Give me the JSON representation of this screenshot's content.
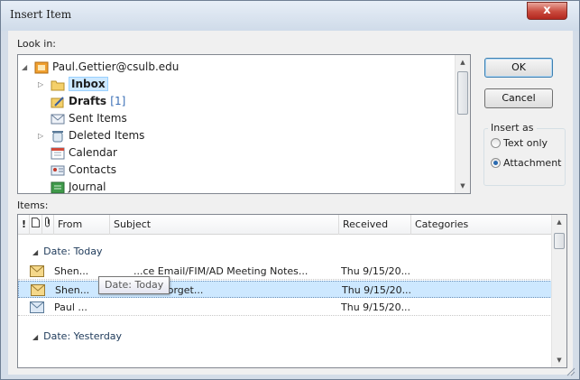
{
  "window": {
    "title": "Insert Item",
    "close_label": "x"
  },
  "look_in": {
    "label": "Look in:",
    "folders": [
      {
        "label": "Paul.Gettier@csulb.edu",
        "icon": "mailbox-icon",
        "expanded": true
      },
      {
        "label": "Inbox",
        "icon": "inbox-folder-icon",
        "bold": true,
        "selected": true
      },
      {
        "label": "Drafts",
        "count": "[1]",
        "icon": "drafts-icon",
        "bold": true
      },
      {
        "label": "Sent Items",
        "icon": "sent-items-icon"
      },
      {
        "label": "Deleted Items",
        "icon": "deleted-items-icon"
      },
      {
        "label": "Calendar",
        "icon": "calendar-icon"
      },
      {
        "label": "Contacts",
        "icon": "contacts-icon"
      },
      {
        "label": "Journal",
        "icon": "journal-icon"
      }
    ]
  },
  "buttons": {
    "ok": "OK",
    "cancel": "Cancel"
  },
  "insert_as": {
    "label": "Insert as",
    "options": [
      {
        "label": "Text only",
        "checked": false
      },
      {
        "label": "Attachment",
        "checked": true
      }
    ]
  },
  "items": {
    "label": "Items:",
    "columns": [
      "!",
      "From",
      "Subject",
      "Received",
      "Categories"
    ],
    "groups": [
      {
        "label": "Date: Today",
        "rows": [
          {
            "from": "Shen...",
            "subject": "...ce Email/FIM/AD Meeting Notes...",
            "received": "Thu 9/15/20...",
            "selected": false
          },
          {
            "from": "Shen...",
            "subject": "RE: Don't Forget...",
            "received": "Thu 9/15/20...",
            "selected": true
          },
          {
            "from": "Paul ...",
            "subject": "",
            "received": "Thu 9/15/20...",
            "selected": false
          }
        ]
      },
      {
        "label": "Date: Yesterday",
        "rows": []
      }
    ],
    "tooltip": "Date: Today"
  },
  "colors": {
    "accent": "#3c7fb1",
    "selection": "#cde8ff",
    "close": "#c94a3d"
  }
}
